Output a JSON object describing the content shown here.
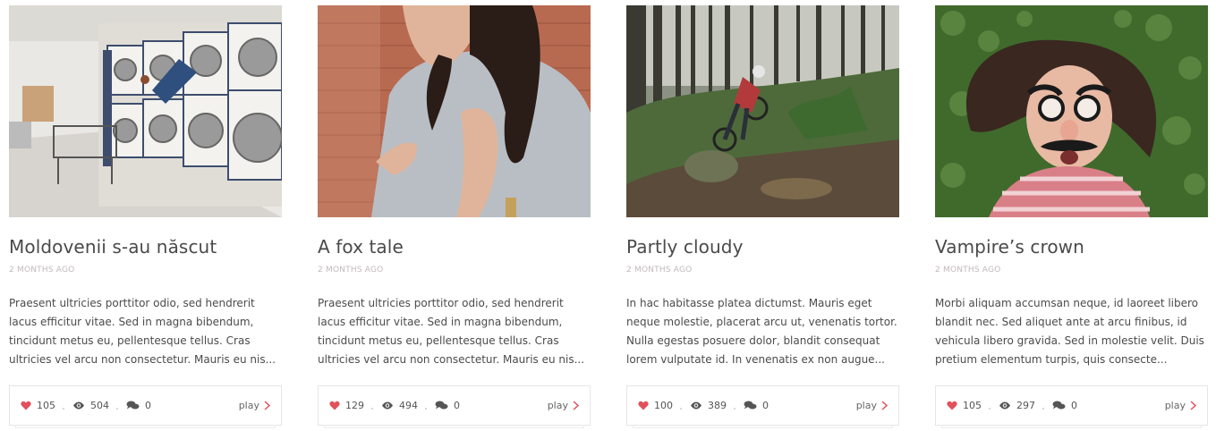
{
  "accent_color": "#e0525c",
  "cards": [
    {
      "title": "Moldovenii s-au născut",
      "date": "2 MONTHS AGO",
      "excerpt": "Praesent ultricies porttitor odio, sed hendrerit lacus efficitur vitae. Sed in magna bibendum, tincidunt metus eu, pellentesque tellus. Cras ultricies vel arcu non consectetur. Mauris eu nis...",
      "likes": "105",
      "views": "504",
      "comments": "0",
      "play_label": "play",
      "image": "laundromat-photo"
    },
    {
      "title": "A fox tale",
      "date": "2 MONTHS AGO",
      "excerpt": "Praesent ultricies porttitor odio, sed hendrerit lacus efficitur vitae. Sed in magna bibendum, tincidunt metus eu, pellentesque tellus. Cras ultricies vel arcu non consectetur. Mauris eu nis...",
      "likes": "129",
      "views": "494",
      "comments": "0",
      "play_label": "play",
      "image": "woman-portrait-photo"
    },
    {
      "title": "Partly cloudy",
      "date": "2 MONTHS AGO",
      "excerpt": "In hac habitasse platea dictumst. Mauris eget neque molestie, placerat arcu ut, venenatis tortor. Nulla egestas posuere dolor, blandit consequat lorem vulputate id. In venenatis ex non augue...",
      "likes": "100",
      "views": "389",
      "comments": "0",
      "play_label": "play",
      "image": "forest-biker-photo"
    },
    {
      "title": "Vampire’s crown",
      "date": "2 MONTHS AGO",
      "excerpt": "Morbi aliquam accumsan neque, id laoreet libero blandit nec. Sed aliquet ante at arcu finibus, id vehicula libero gravida. Sed in molestie velit. Duis pretium elementum turpis, quis consecte...",
      "likes": "105",
      "views": "297",
      "comments": "0",
      "play_label": "play",
      "image": "disguise-glasses-photo"
    }
  ]
}
